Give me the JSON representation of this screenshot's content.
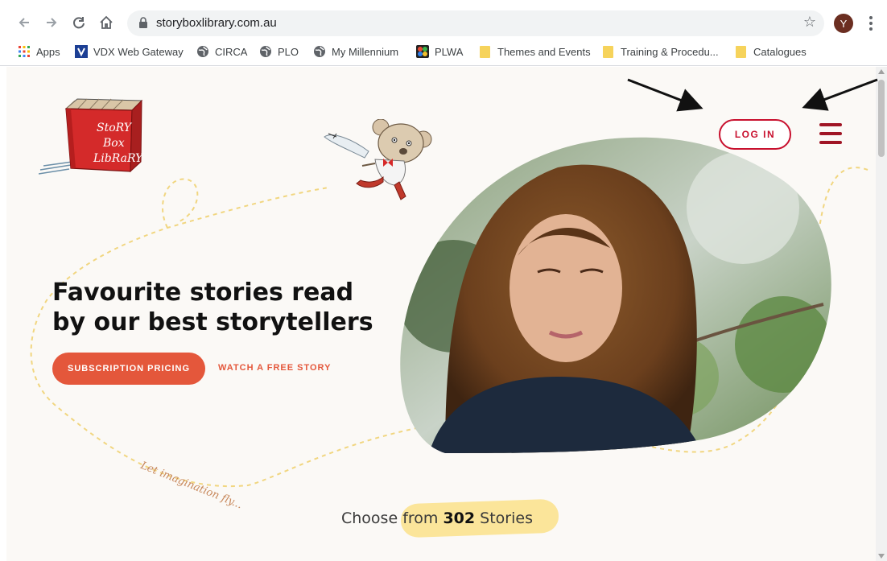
{
  "browser": {
    "url": "storyboxlibrary.com.au",
    "avatar_letter": "Y",
    "bookmarks": [
      {
        "label": "Apps"
      },
      {
        "label": "VDX Web Gateway"
      },
      {
        "label": "CIRCA"
      },
      {
        "label": "PLO"
      },
      {
        "label": "My Millennium"
      },
      {
        "label": "PLWA"
      },
      {
        "label": "Themes and Events"
      },
      {
        "label": "Training & Procedu..."
      },
      {
        "label": "Catalogues"
      }
    ]
  },
  "site": {
    "logo_text": [
      "StoRY",
      "Box",
      "LibRaRY"
    ],
    "login_label": "LOG IN",
    "headline_line1": "Favourite stories read",
    "headline_line2": "by our best storytellers",
    "cta_primary": "SUBSCRIPTION PRICING",
    "cta_secondary": "WATCH A FREE STORY",
    "tagline": "Let imagination fly...",
    "choose_prefix": "Choose ",
    "choose_from": "from ",
    "choose_count": "302",
    "choose_suffix": " Stories"
  },
  "colors": {
    "brand_red": "#c8102e",
    "cta_orange": "#e4573b",
    "page_bg": "#fbf9f6",
    "highlight_yellow": "#fbe59a"
  }
}
